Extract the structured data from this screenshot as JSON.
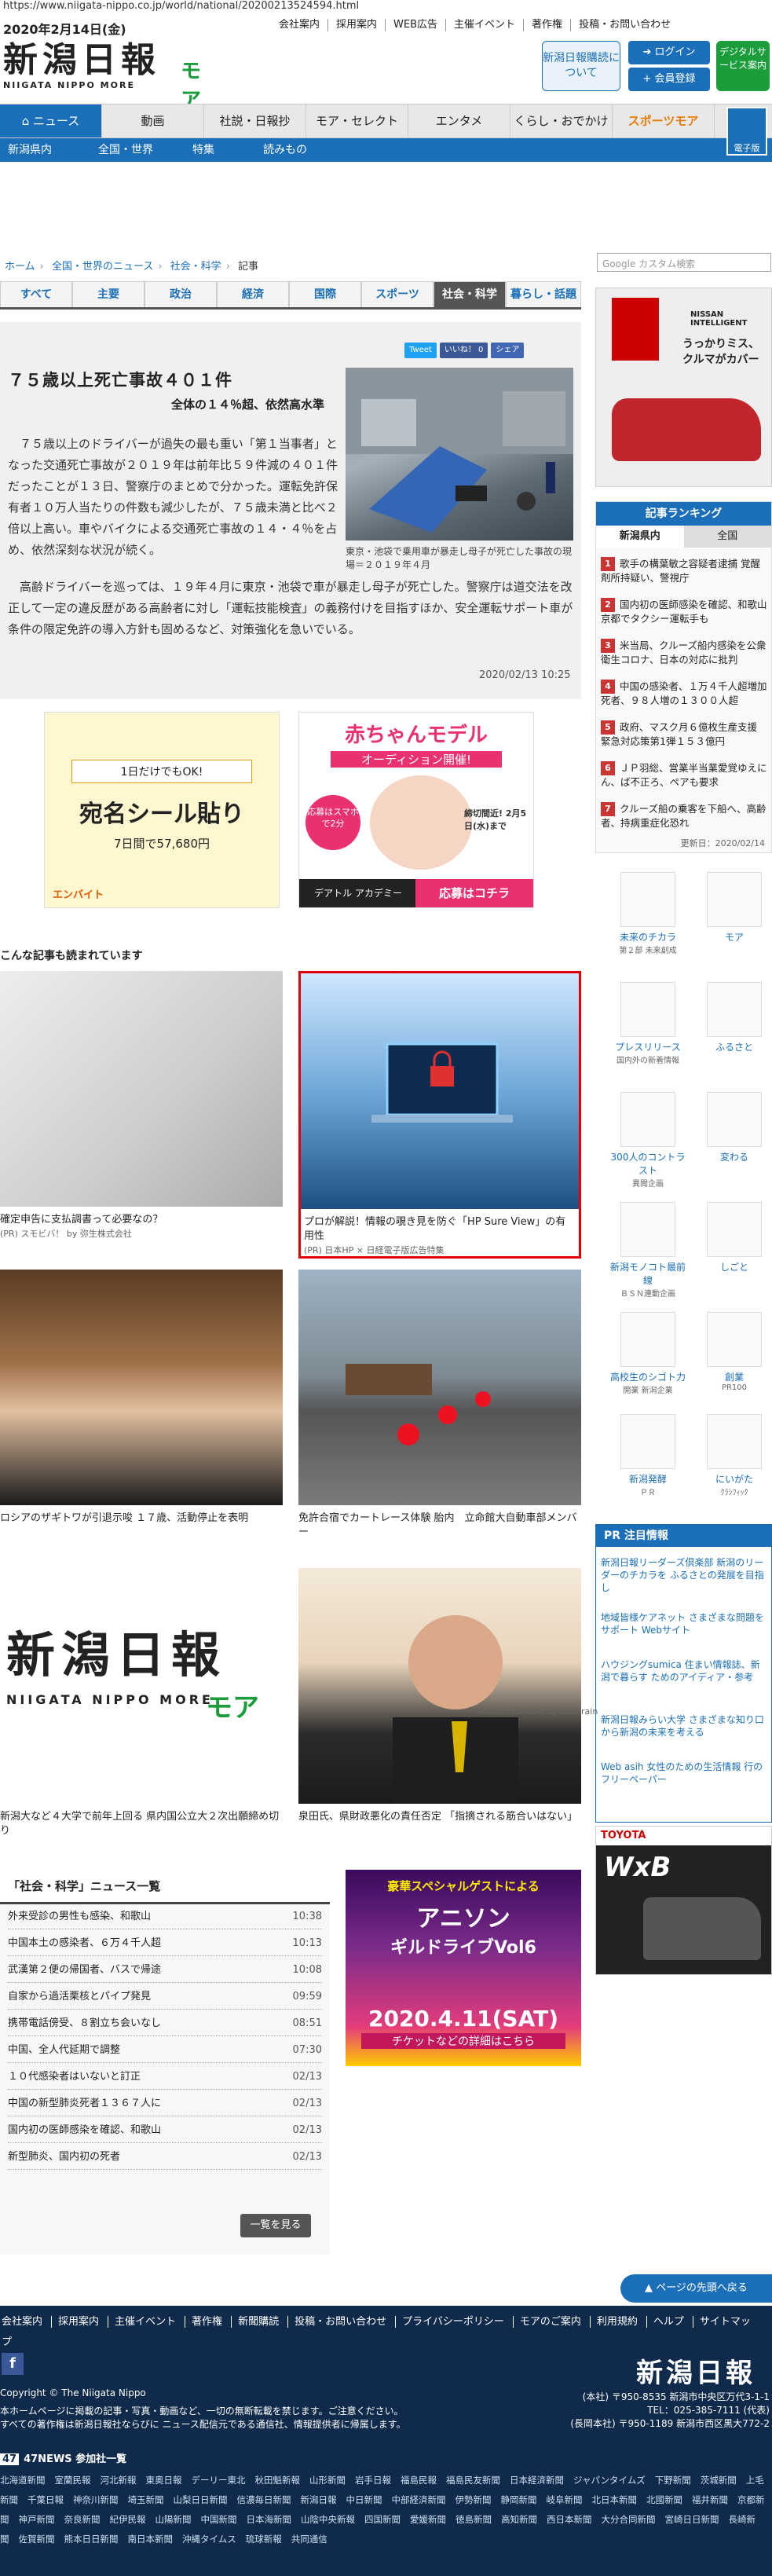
{
  "url": "https://www.niigata-nippo.co.jp/world/national/20200213524594.html",
  "header": {
    "date": "2020年2月14日(金)",
    "toplinks": [
      "会社案内",
      "採用案内",
      "WEB広告",
      "主催イベント",
      "著作権",
      "投稿・お問い合わせ"
    ],
    "logo_title": "新潟日報",
    "logo_sub": "NIIGATA NIPPO MORE",
    "logo_moa": "モア",
    "subscribe": "新潟日報購読について",
    "login": "ログイン",
    "register": "会員登録",
    "digital": "デジタルサービス案内",
    "ebook": "電子版"
  },
  "nav": {
    "items": [
      "ニュース",
      "動画",
      "社説・日報抄",
      "モア・セレクト",
      "エンタメ",
      "くらし・おでかけ",
      "スポーツモア"
    ],
    "sub": [
      "新潟県内",
      "全国・世界",
      "特集",
      "読みもの"
    ]
  },
  "breadcrumb": [
    "ホーム",
    "全国・世界のニュース",
    "社会・科学",
    "記事"
  ],
  "search_placeholder": "Google カスタム検索",
  "cat_tabs": [
    "すべて",
    "主要",
    "政治",
    "経済",
    "国際",
    "スポーツ",
    "社会・科学",
    "暮らし・話題"
  ],
  "article": {
    "share": [
      "Tweet",
      "いいね！ 0",
      "シェア"
    ],
    "title": "７５歳以上死亡事故４０１件",
    "subtitle": "全体の１４％超、依然高水準",
    "p1": "７５歳以上のドライバーが過失の最も重い「第１当事者」となった交通死亡事故が２０１９年は前年比５９件減の４０１件だったことが１３日、警察庁のまとめで分かった。運転免許保有者１０万人当たりの件数も減少したが、７５歳未満と比べ２倍以上高い。車やバイクによる交通死亡事故の１４・４％を占め、依然深刻な状況が続く。",
    "p2": "高齢ドライバーを巡っては、１９年４月に東京・池袋で車が暴走し母子が死亡した。警察庁は道交法を改正して一定の違反歴がある高齢者に対し「運転技能検査」の義務付けを目指すほか、安全運転サポート車が条件の限定免許の導入方針も固めるなど、対策強化を急いでいる。",
    "caption": "東京・池袋で乗用車が暴走し母子が死亡した事故の現場＝２０１９年４月",
    "date": "2020/02/13 10:25"
  },
  "ads": {
    "ad1_top": "1日だけでもOK!",
    "ad1_main": "宛名シール貼り",
    "ad1_price": "7日間で57,680円",
    "ad1_brand": "エンバイト",
    "ad2_main": "赤ちゃんモデル",
    "ad2_sub": "オーディション開催!",
    "ad2_badge": "応募はスマホで2分",
    "ad2_date": "締切間近! 2月5日(水)まで",
    "ad2_brand": "デアトル アカデミー",
    "ad2_cta": "応募はコチラ"
  },
  "reco": {
    "heading": "こんな記事も読まれています",
    "cards": [
      {
        "cap": "確定申告に支払調書って必要なの？",
        "sp": "(PR) スモビバ！ by 弥生株式会社"
      },
      {
        "cap": "プロが解説！情報の覗き見を防ぐ「HP Sure View」の有用性",
        "sp": "(PR) 日本HP × 日経電子版広告特集"
      },
      {
        "cap": "ロシアのザギトワが引退示唆 １７歳、活動停止を表明",
        "sp": ""
      },
      {
        "cap": "免許合宿でカートレース体験 胎内　立命館大自動車部メンバー",
        "sp": ""
      },
      {
        "cap": "新潟大など４大学で前年上回る 県内国公立大２次出願締め切り",
        "sp": ""
      },
      {
        "cap": "泉田氏、県財政悪化の責任否定 「指摘される筋合いはない」",
        "sp": ""
      }
    ],
    "logo_big": "新潟日報",
    "logo_big_sub": "NIIGATA NIPPO MORE",
    "logo_big_moa": "モア",
    "outbrain": "Recommended by Outbrain"
  },
  "newslist": {
    "heading": "「社会・科学」ニュース一覧",
    "items": [
      {
        "t": "外来受診の男性も感染、和歌山",
        "tm": "10:38"
      },
      {
        "t": "中国本土の感染者、６万４千人超",
        "tm": "10:13"
      },
      {
        "t": "武漢第２便の帰国者、バスで帰途",
        "tm": "10:08"
      },
      {
        "t": "自家から過活栗核とパイプ発見",
        "tm": "09:59"
      },
      {
        "t": "携帯電話傍受、８割立ち会いなし",
        "tm": "08:51"
      },
      {
        "t": "中国、全人代延期で調整",
        "tm": "07:30"
      },
      {
        "t": "１０代感染者はいないと訂正",
        "tm": "02/13"
      },
      {
        "t": "中国の新型肺炎死者１３６７人に",
        "tm": "02/13"
      },
      {
        "t": "国内初の医師感染を確認、和歌山",
        "tm": "02/13"
      },
      {
        "t": "新型肺炎、国内初の死者",
        "tm": "02/13"
      }
    ],
    "more": "一覧を見る"
  },
  "ad3": {
    "l1": "豪華スペシャルゲストによる",
    "l2": "アニソン",
    "l3": "ギルドライブVol6",
    "l4": "2020.4.11(SAT)",
    "l5": "チケットなどの詳細はこちら"
  },
  "side": {
    "ad_brand": "NISSAN INTELLIGENT",
    "ad_copy": "うっかりミス、クルマがカバー",
    "ranking_head": "記事ランキング",
    "ranking_tabs": [
      "新潟県内",
      "全国"
    ],
    "ranking": [
      "歌手の構葉敏之容疑者逮捕 覚醒剤所持疑い、警視庁",
      "国内初の医師感染を確認、和歌山 京都でタクシー運転手も",
      "米当局、クルーズ船内感染を公衆衛生コロナ、日本の対応に批判",
      "中国の感染者、１万４千人超増加 死者、９８人増の１３００人超",
      "政府、マスク月６億枚生産支援 緊急対応策第1弾１５３億円",
      "ＪＰ羽総、営業半当業愛覚ゆえに ん、ば不正ろ、ペアも要求",
      "クルーズ船の乗客を下船へ、高齢 者、持病重症化恐れ"
    ],
    "ranking_updated": "更新日：2020/02/14",
    "services": [
      {
        "n": "未来のチカラ",
        "d": "第２部 未来創成"
      },
      {
        "n": "モア",
        "d": ""
      },
      {
        "n": "プレスリリース",
        "d": "国内外の新着情報"
      },
      {
        "n": "ふるさと",
        "d": ""
      },
      {
        "n": "300人のコントラスト",
        "d": "異聞企画"
      },
      {
        "n": "変わる",
        "d": ""
      },
      {
        "n": "新潟モノコト最前線",
        "d": "ＢＳＮ連動企画"
      },
      {
        "n": "しごと",
        "d": ""
      },
      {
        "n": "高校生のシゴト力",
        "d": "開業 新潟企業"
      },
      {
        "n": "創業",
        "d": "PR100"
      },
      {
        "n": "新潟発酵",
        "d": "ＰＲ"
      },
      {
        "n": "にいがた",
        "d": "ｸﾗｼﾌｨｯｸ"
      }
    ],
    "pr_head": "PR 注目情報",
    "pr": [
      "新潟日報リーダーズ倶楽部 新潟のリーダーのチカラを ふるさとの発展を目指し",
      "地域皆様ケアネット さまざまな問題をサポート Webサイト",
      "ハウジングsumica 住まい情報誌、新潟で暮らす ためのアイディア・参考",
      "新潟日報みらい大学 さまざまな知り口から新潟の未来を考える",
      "Web asih 女性のための生活情報 行のフリーペーパー"
    ],
    "toyota_brand": "TOYOTA",
    "toyota_car": "WxB"
  },
  "pagetop": "ページの先頭へ戻る",
  "footer": {
    "links": [
      "会社案内",
      "採用案内",
      "主催イベント",
      "著作権",
      "新聞購読",
      "投稿・お問い合わせ",
      "プライバシーポリシー",
      "モアのご案内",
      "利用規約",
      "ヘルプ",
      "サイトマップ"
    ],
    "fb": "f",
    "copy": "Copyright © The Niigata Nippo",
    "note1": "本ホームページに掲載の記事・写真・動画など、一切の無断転載を禁じます。ご注意ください。",
    "note2": "すべての著作権は新潟日報社ならびに ニュース配信元である通信社、情報提供者に帰属します。",
    "logo": "新潟日報",
    "addr1": "(本社) 〒950-8535 新潟市中央区万代3-1-1",
    "addr2": "TEL：025-385-7111 (代表)",
    "addr3": "(長岡本社) 〒950-1189 新潟市西区黒大772-2",
    "f47_tag": "47",
    "f47": "47NEWS 参加社一覧",
    "papers": [
      "北海道新聞",
      "室蘭民報",
      "河北新報",
      "東奥日報",
      "デーリー東北",
      "秋田魁新報",
      "山形新聞",
      "岩手日報",
      "福島民報",
      "福島民友新聞",
      "日本経済新聞",
      "ジャパンタイムズ",
      "下野新聞",
      "茨城新聞",
      "上毛新聞",
      "千葉日報",
      "神奈川新聞",
      "埼玉新聞",
      "山梨日日新聞",
      "信濃毎日新聞",
      "新潟日報",
      "中日新聞",
      "中部経済新聞",
      "伊勢新聞",
      "静岡新聞",
      "岐阜新聞",
      "北日本新聞",
      "北國新聞",
      "福井新聞",
      "京都新聞",
      "神戸新聞",
      "奈良新聞",
      "紀伊民報",
      "山陽新聞",
      "中国新聞",
      "日本海新聞",
      "山陰中央新報",
      "四国新聞",
      "愛媛新聞",
      "徳島新聞",
      "高知新聞",
      "西日本新聞",
      "大分合同新聞",
      "宮崎日日新聞",
      "長崎新聞",
      "佐賀新聞",
      "熊本日日新聞",
      "南日本新聞",
      "沖縄タイムス",
      "琉球新報",
      "共同通信"
    ]
  },
  "colors": {
    "brand": "#1b6fb8",
    "footer": "#0f2a4a",
    "green": "#1a9d3a"
  }
}
